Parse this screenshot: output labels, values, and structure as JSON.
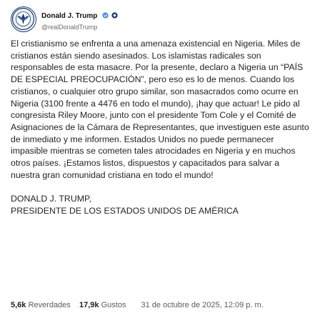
{
  "post": {
    "author": {
      "display_name": "Donald J. Trump",
      "handle": "@realDonaldTrump",
      "avatar_icon": "presidential-seal-avatar",
      "verified_icon": "verified-badge-icon",
      "affiliation_icon": "affiliation-badge-icon"
    },
    "body": {
      "paragraph_1": "El cristianismo se enfrenta a una amenaza existencial en Nigeria. Miles de cristianos están siendo asesinados. Los islamistas radicales son responsables de esta masacre. Por la presente, declaro a Nigeria un “PAÍS DE ESPECIAL PREOCUPACIÓN”, pero eso es lo de menos. Cuando los cristianos, o cualquier otro grupo similar, son masacrados como ocurre en Nigeria (3100 frente a 4476 en todo el mundo), ¡hay que actuar! Le pido al congresista Riley Moore, junto con el presidente Tom Cole y el Comité de Asignaciones de la Cámara de Representantes, que investiguen este asunto de inmediato y me informen. Estados Unidos no puede permanecer impasible mientras se cometen tales atrocidades en Nigeria y en muchos otros países. ¡Estamos listos, dispuestos y capacitados para salvar a nuestra gran comunidad cristiana en todo el mundo!",
      "signature_line_1": "DONALD J. TRUMP,",
      "signature_line_2": "PRESIDENTE DE LOS ESTADOS UNIDOS DE AMÉRICA"
    },
    "stats": {
      "reposts_count": "5,6k",
      "reposts_label": "Reverdades",
      "likes_count": "17,9k",
      "likes_label": "Gustos",
      "timestamp": "31 de octubre de 2025, 12:09 p. m."
    }
  },
  "colors": {
    "verified_badge": "#4a90e2",
    "seal_blue": "#1b3a6b",
    "text": "#232323",
    "muted": "#5c5c5c"
  }
}
